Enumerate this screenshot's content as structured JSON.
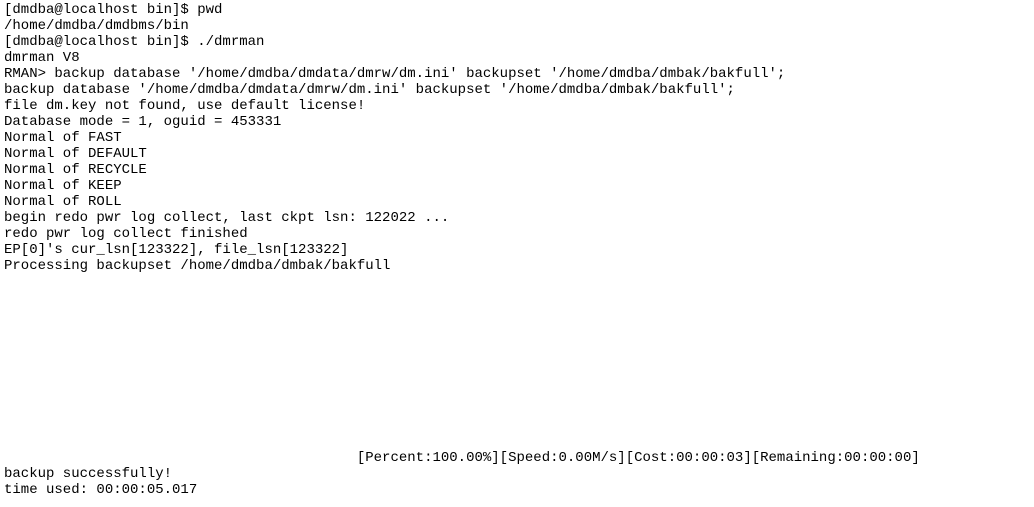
{
  "lines": [
    "[dmdba@localhost bin]$ pwd",
    "/home/dmdba/dmdbms/bin",
    "[dmdba@localhost bin]$ ./dmrman",
    "dmrman V8",
    "RMAN> backup database '/home/dmdba/dmdata/dmrw/dm.ini' backupset '/home/dmdba/dmbak/bakfull';",
    "backup database '/home/dmdba/dmdata/dmrw/dm.ini' backupset '/home/dmdba/dmbak/bakfull';",
    "file dm.key not found, use default license!",
    "Database mode = 1, oguid = 453331",
    "Normal of FAST",
    "Normal of DEFAULT",
    "Normal of RECYCLE",
    "Normal of KEEP",
    "Normal of ROLL",
    "begin redo pwr log collect, last ckpt lsn: 122022 ...",
    "redo pwr log collect finished",
    "EP[0]'s cur_lsn[123322], file_lsn[123322]",
    "Processing backupset /home/dmdba/dmbak/bakfull",
    "",
    "",
    "",
    "",
    "",
    "",
    "",
    "",
    "",
    "",
    "",
    "                                          [Percent:100.00%][Speed:0.00M/s][Cost:00:00:03][Remaining:00:00:00]",
    "backup successfully!",
    "time used: 00:00:05.017"
  ]
}
